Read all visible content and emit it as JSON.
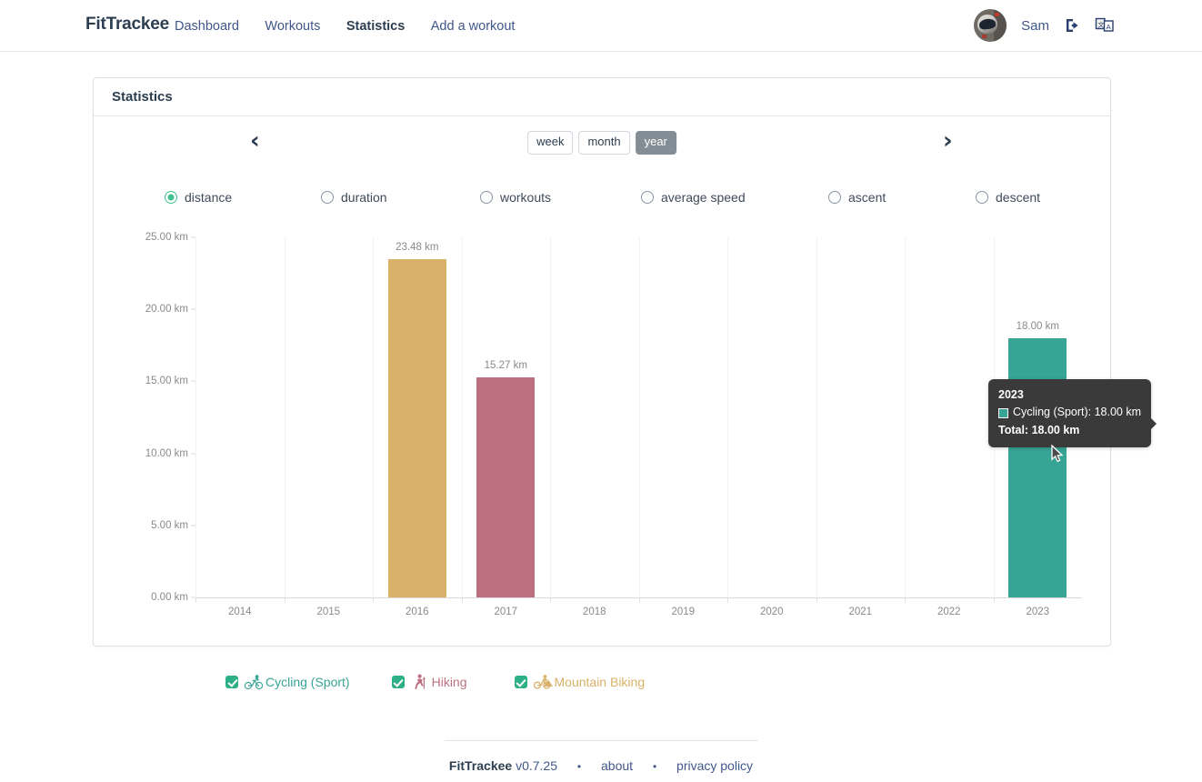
{
  "header": {
    "brand": "FitTrackee",
    "nav": [
      {
        "label": "Dashboard",
        "active": false
      },
      {
        "label": "Workouts",
        "active": false
      },
      {
        "label": "Statistics",
        "active": true
      },
      {
        "label": "Add a workout",
        "active": false
      }
    ],
    "username": "Sam",
    "logout_icon": "sign-out-icon",
    "language_icon": "translate-icon",
    "avatar_icon": "user-avatar"
  },
  "card": {
    "title": "Statistics"
  },
  "controls": {
    "prev_label": "‹",
    "next_label": "›",
    "periods": [
      {
        "label": "week",
        "active": false
      },
      {
        "label": "month",
        "active": false
      },
      {
        "label": "year",
        "active": true
      }
    ],
    "metrics": [
      {
        "label": "distance",
        "checked": true
      },
      {
        "label": "duration",
        "checked": false
      },
      {
        "label": "workouts",
        "checked": false
      },
      {
        "label": "average speed",
        "checked": false
      },
      {
        "label": "ascent",
        "checked": false
      },
      {
        "label": "descent",
        "checked": false
      }
    ]
  },
  "tooltip": {
    "title": "2023",
    "series_label": "Cycling (Sport): 18.00 km",
    "total_label": "Total: 18.00 km",
    "swatch_color": "#37a495"
  },
  "legend": [
    {
      "label": "Cycling (Sport)",
      "color": "#37a495",
      "checked": true,
      "icon": "cycling-icon"
    },
    {
      "label": "Hiking",
      "color": "#bd7080",
      "checked": true,
      "icon": "hiking-icon"
    },
    {
      "label": "Mountain Biking",
      "color": "#d9b168",
      "checked": true,
      "icon": "mountain-biking-icon"
    }
  ],
  "footer": {
    "brand": "FitTrackee",
    "version": "v0.7.25",
    "separator": "•",
    "about": "about",
    "privacy": "privacy policy"
  },
  "chart_data": {
    "type": "bar",
    "title": "",
    "xlabel": "",
    "ylabel": "",
    "unit": "km",
    "categories": [
      "2014",
      "2015",
      "2016",
      "2017",
      "2018",
      "2019",
      "2020",
      "2021",
      "2022",
      "2023"
    ],
    "ytick_labels": [
      "25.00 km",
      "20.00 km",
      "15.00 km",
      "10.00 km",
      "5.00 km",
      "0.00 km"
    ],
    "ytick_values": [
      25,
      20,
      15,
      10,
      5,
      0
    ],
    "ylim": [
      0,
      25
    ],
    "grid": true,
    "legend_position": "bottom",
    "series": [
      {
        "name": "Cycling (Sport)",
        "color": "#37a495",
        "values": [
          0,
          0,
          0,
          0,
          0,
          0,
          0,
          0,
          0,
          18.0
        ]
      },
      {
        "name": "Hiking",
        "color": "#bd7080",
        "values": [
          0,
          0,
          0,
          15.27,
          0,
          0,
          0,
          0,
          0,
          0
        ]
      },
      {
        "name": "Mountain Biking",
        "color": "#d9b168",
        "values": [
          0,
          0,
          23.48,
          0,
          0,
          0,
          0,
          0,
          0,
          0
        ]
      }
    ],
    "bar_labels": [
      {
        "category": "2016",
        "text": "23.48 km",
        "value": 23.48
      },
      {
        "category": "2017",
        "text": "15.27 km",
        "value": 15.27
      },
      {
        "category": "2023",
        "text": "18.00 km",
        "value": 18.0
      }
    ]
  }
}
